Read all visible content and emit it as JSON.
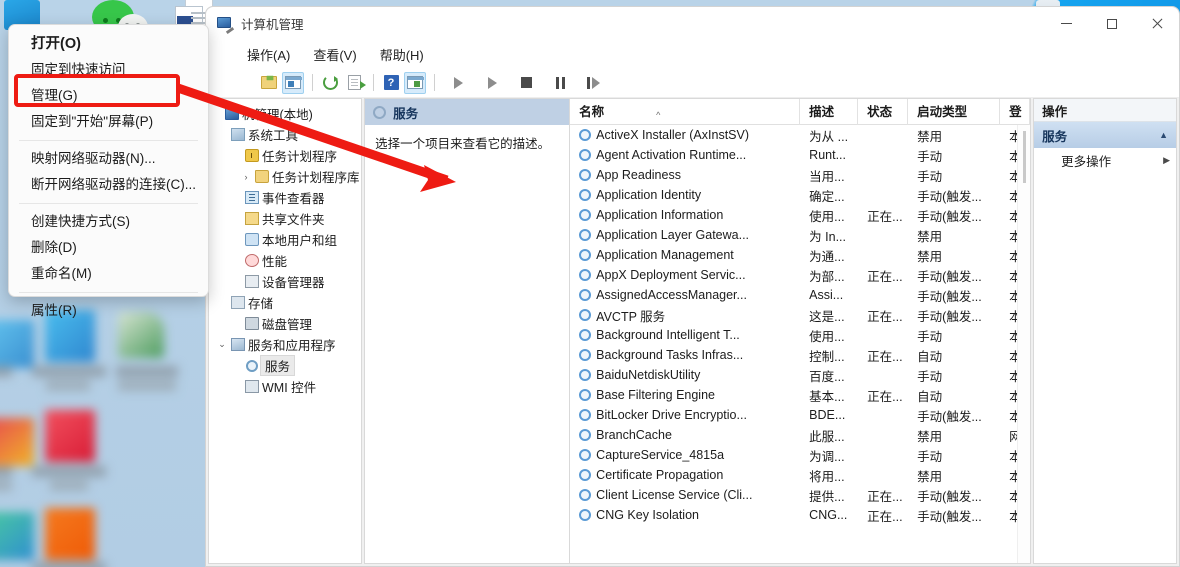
{
  "context_menu": {
    "items": [
      {
        "label": "打开(O)",
        "bold": true
      },
      {
        "label": "固定到快速访问",
        "bold": false
      },
      {
        "label": "管理(G)",
        "bold": false,
        "highlighted": true
      },
      {
        "label": "固定到\"开始\"屏幕(P)",
        "bold": false
      },
      {
        "sep": true
      },
      {
        "label": "映射网络驱动器(N)...",
        "bold": false
      },
      {
        "label": "断开网络驱动器的连接(C)...",
        "bold": false
      },
      {
        "sep": true
      },
      {
        "label": "创建快捷方式(S)",
        "bold": false
      },
      {
        "label": "删除(D)",
        "bold": false
      },
      {
        "label": "重命名(M)",
        "bold": false
      },
      {
        "sep": true
      },
      {
        "label": "属性(R)",
        "bold": false
      }
    ]
  },
  "window": {
    "title": "计算机管理",
    "controls": {
      "minimize": "最小化",
      "maximize": "最大化",
      "close": "关闭"
    },
    "menus": [
      "操作(A)",
      "查看(V)",
      "帮助(H)"
    ],
    "toolbar": [
      {
        "name": "up-folder",
        "active": false
      },
      {
        "name": "show-hide-tree",
        "active": true
      },
      {
        "name": "refresh",
        "active": false
      },
      {
        "name": "export-list",
        "active": false
      },
      {
        "name": "help",
        "active": false
      },
      {
        "name": "show-hide-action-pane",
        "active": true
      },
      {
        "name": "start-service",
        "active": false
      },
      {
        "name": "resume-service",
        "active": false
      },
      {
        "name": "stop-service",
        "active": false
      },
      {
        "name": "pause-service",
        "active": false
      },
      {
        "name": "restart-service",
        "active": false
      }
    ]
  },
  "tree": {
    "items": [
      {
        "label": "机管理(本地)",
        "indent": 0,
        "icon": "computer",
        "twisty": "",
        "selected": false
      },
      {
        "label": "系统工具",
        "indent": 1,
        "icon": "tools",
        "twisty": "",
        "selected": false
      },
      {
        "label": "任务计划程序",
        "indent": 2,
        "icon": "clock",
        "twisty": "",
        "selected": false
      },
      {
        "label": "任务计划程序库",
        "indent": 3,
        "icon": "folder",
        "twisty": "›",
        "selected": false
      },
      {
        "label": "事件查看器",
        "indent": 2,
        "icon": "event",
        "twisty": "",
        "selected": false
      },
      {
        "label": "共享文件夹",
        "indent": 2,
        "icon": "share",
        "twisty": "",
        "selected": false
      },
      {
        "label": "本地用户和组",
        "indent": 2,
        "icon": "users",
        "twisty": "",
        "selected": false
      },
      {
        "label": "性能",
        "indent": 2,
        "icon": "perf",
        "twisty": "",
        "selected": false
      },
      {
        "label": "设备管理器",
        "indent": 2,
        "icon": "device",
        "twisty": "",
        "selected": false
      },
      {
        "label": "存储",
        "indent": 1,
        "icon": "storage",
        "twisty": "",
        "selected": false
      },
      {
        "label": "磁盘管理",
        "indent": 2,
        "icon": "disk",
        "twisty": "",
        "selected": false
      },
      {
        "label": "服务和应用程序",
        "indent": 1,
        "icon": "svcapp",
        "twisty": "⌄",
        "selected": false
      },
      {
        "label": "服务",
        "indent": 2,
        "icon": "gear",
        "twisty": "",
        "selected": true
      },
      {
        "label": "WMI 控件",
        "indent": 2,
        "icon": "wmi",
        "twisty": "",
        "selected": false
      }
    ]
  },
  "detail_pane": {
    "header": "服务",
    "body_text": "选择一个项目来查看它的描述。"
  },
  "services_list": {
    "columns": [
      "名称",
      "描述",
      "状态",
      "启动类型",
      "登"
    ],
    "sort_column": "名称",
    "sort_direction": "ascending",
    "rows": [
      {
        "name": "ActiveX Installer (AxInstSV)",
        "desc": "为从 ...",
        "status": "",
        "startup": "禁用",
        "logon": "本"
      },
      {
        "name": "Agent Activation Runtime...",
        "desc": "Runt...",
        "status": "",
        "startup": "手动",
        "logon": "本"
      },
      {
        "name": "App Readiness",
        "desc": "当用...",
        "status": "",
        "startup": "手动",
        "logon": "本"
      },
      {
        "name": "Application Identity",
        "desc": "确定...",
        "status": "",
        "startup": "手动(触发...",
        "logon": "本"
      },
      {
        "name": "Application Information",
        "desc": "使用...",
        "status": "正在...",
        "startup": "手动(触发...",
        "logon": "本"
      },
      {
        "name": "Application Layer Gatewa...",
        "desc": "为 In...",
        "status": "",
        "startup": "禁用",
        "logon": "本"
      },
      {
        "name": "Application Management",
        "desc": "为通...",
        "status": "",
        "startup": "禁用",
        "logon": "本"
      },
      {
        "name": "AppX Deployment Servic...",
        "desc": "为部...",
        "status": "正在...",
        "startup": "手动(触发...",
        "logon": "本"
      },
      {
        "name": "AssignedAccessManager...",
        "desc": "Assi...",
        "status": "",
        "startup": "手动(触发...",
        "logon": "本"
      },
      {
        "name": "AVCTP 服务",
        "desc": "这是...",
        "status": "正在...",
        "startup": "手动(触发...",
        "logon": "本"
      },
      {
        "name": "Background Intelligent T...",
        "desc": "使用...",
        "status": "",
        "startup": "手动",
        "logon": "本"
      },
      {
        "name": "Background Tasks Infras...",
        "desc": "控制...",
        "status": "正在...",
        "startup": "自动",
        "logon": "本"
      },
      {
        "name": "BaiduNetdiskUtility",
        "desc": "百度...",
        "status": "",
        "startup": "手动",
        "logon": "本"
      },
      {
        "name": "Base Filtering Engine",
        "desc": "基本...",
        "status": "正在...",
        "startup": "自动",
        "logon": "本"
      },
      {
        "name": "BitLocker Drive Encryptio...",
        "desc": "BDE...",
        "status": "",
        "startup": "手动(触发...",
        "logon": "本"
      },
      {
        "name": "BranchCache",
        "desc": "此服...",
        "status": "",
        "startup": "禁用",
        "logon": "网"
      },
      {
        "name": "CaptureService_4815a",
        "desc": "为调...",
        "status": "",
        "startup": "手动",
        "logon": "本"
      },
      {
        "name": "Certificate Propagation",
        "desc": "将用...",
        "status": "",
        "startup": "禁用",
        "logon": "本"
      },
      {
        "name": "Client License Service (Cli...",
        "desc": "提供...",
        "status": "正在...",
        "startup": "手动(触发...",
        "logon": "本"
      },
      {
        "name": "CNG Key Isolation",
        "desc": "CNG...",
        "status": "正在...",
        "startup": "手动(触发...",
        "logon": "本"
      }
    ]
  },
  "actions_pane": {
    "header": "操作",
    "group_label": "服务",
    "items": [
      {
        "label": "更多操作",
        "has_submenu": true
      }
    ]
  },
  "annotations": {
    "highlight_target": "管理(G)",
    "arrow_color": "#ee1b13",
    "box_color": "#ee1b13"
  },
  "desktop": {
    "icons": [
      "blue-tile-icon",
      "wechat-icon",
      "document-icon"
    ]
  },
  "colors": {
    "accent": "#0078d4",
    "annotation_red": "#ee1b13",
    "header_blue": "#bfd0e4",
    "desktop_blue": "#b5d0e6"
  }
}
